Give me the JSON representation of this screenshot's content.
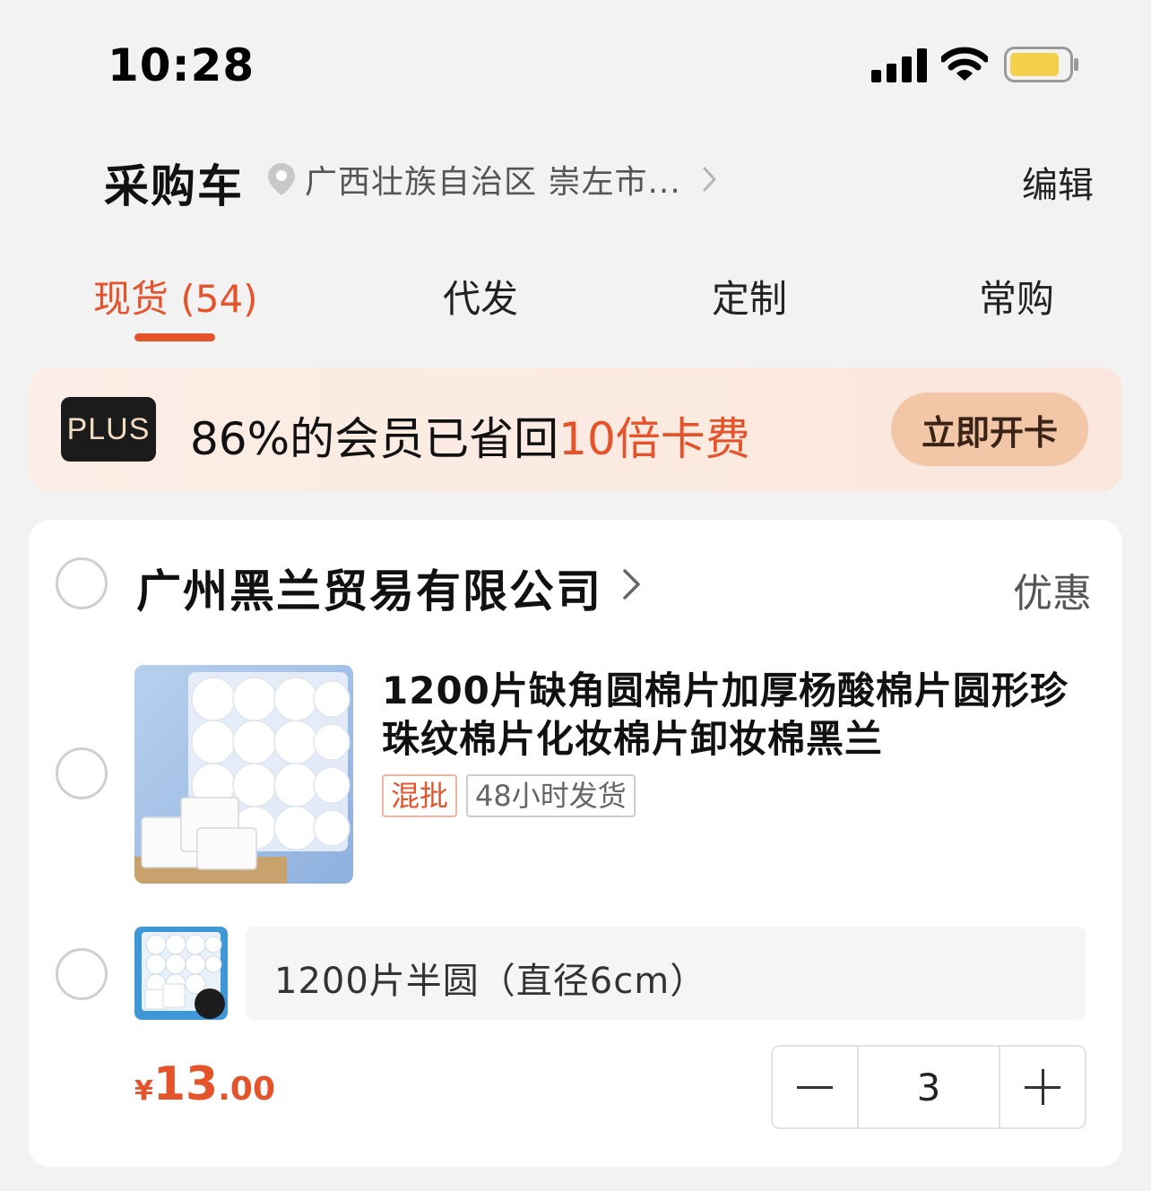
{
  "status_bar": {
    "time": "10:28"
  },
  "header": {
    "title": "采购车",
    "location": "广西壮族自治区 崇左市...",
    "edit_label": "编辑"
  },
  "tabs": [
    {
      "label": "现货 (54)",
      "active": true
    },
    {
      "label": "代发",
      "active": false
    },
    {
      "label": "定制",
      "active": false
    },
    {
      "label": "常购",
      "active": false
    }
  ],
  "plus_banner": {
    "badge": "PLUS",
    "text_prefix": "86%的会员已省回",
    "text_highlight": "10倍卡费",
    "button_label": "立即开卡"
  },
  "shop": {
    "name": "广州黑兰贸易有限公司",
    "discount_label": "优惠"
  },
  "product": {
    "title": "1200片缺角圆棉片加厚杨酸棉片圆形珍珠纹棉片化妆棉片卸妆棉黑兰",
    "tags": [
      "混批",
      "48小时发货"
    ],
    "sku": "1200片半圆（直径6cm）",
    "price_symbol": "¥",
    "price_int": "13",
    "price_dec": ".00",
    "quantity": "3"
  },
  "colors": {
    "accent": "#e5532a",
    "background": "#f2f2f2",
    "plus_button": "#f2c7a8"
  }
}
